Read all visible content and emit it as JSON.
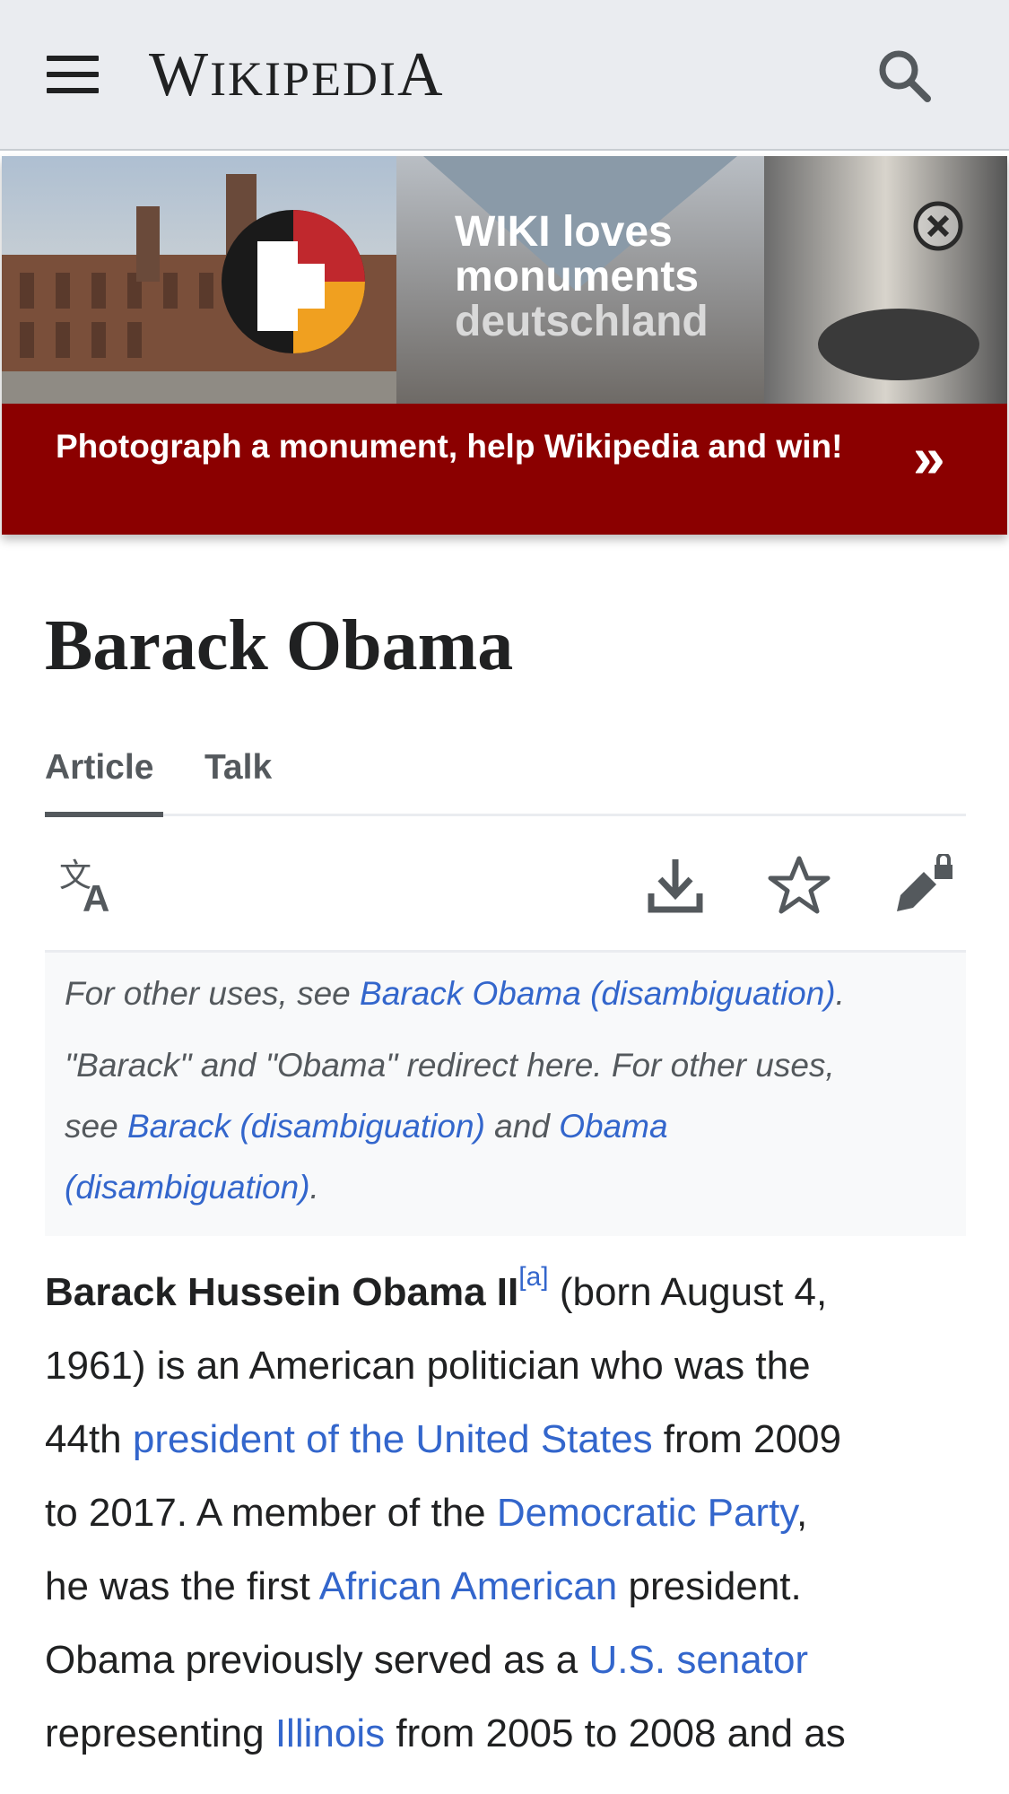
{
  "header": {
    "wordmark_w": "W",
    "wordmark_rest": "IKIPEDI",
    "wordmark_a": "A"
  },
  "banner": {
    "image_caption_line1": "WIKI loves",
    "image_caption_line2": "monuments",
    "image_caption_line3": "deutschland",
    "cta_text": "Photograph a monument, help Wikipedia and win!",
    "cta_arrow": "»",
    "colors": {
      "bar": "#8b0000"
    }
  },
  "page": {
    "title": "Barack Obama"
  },
  "tabs": [
    {
      "label": "Article",
      "selected": true
    },
    {
      "label": "Talk",
      "selected": false
    }
  ],
  "hatnote": {
    "line1_prefix": "For other uses, see ",
    "line1_link": "Barack Obama (disambiguation)",
    "line1_suffix": ".",
    "line2": "\"Barack\" and \"Obama\" redirect here. For other uses,",
    "line3_prefix": "see ",
    "line3_link1": "Barack (disambiguation)",
    "line3_mid": " and ",
    "line3_link2": "Obama",
    "line4_link2_cont": "(disambiguation)",
    "line4_suffix": "."
  },
  "article": {
    "l1_bold": "Barack Hussein Obama II",
    "l1_sup": "[a]",
    "l1_rest": " (born August 4,",
    "l2": "1961) is an American politician who was the",
    "l3_pre": "44th ",
    "l3_link": "president of the United States",
    "l3_post": " from 2009",
    "l4_pre": "to 2017. A member of the ",
    "l4_link": "Democratic Party",
    "l4_post": ",",
    "l5_pre": "he was the first ",
    "l5_link": "African American",
    "l5_post": " president.",
    "l6_pre": "Obama previously served as a ",
    "l6_link": "U.S. senator",
    "l7_pre": "representing ",
    "l7_link": "Illinois",
    "l7_post": " from 2005 to 2008 and as"
  },
  "icons": {
    "menu": "menu-icon",
    "search": "search-icon",
    "close": "close-icon",
    "language": "language-icon",
    "download": "download-icon",
    "watch": "star-icon",
    "edit": "edit-lock-icon"
  },
  "colors": {
    "link": "#3366cc",
    "header_bg": "#eaecf0",
    "hatnote_bg": "#f8f9fa"
  }
}
